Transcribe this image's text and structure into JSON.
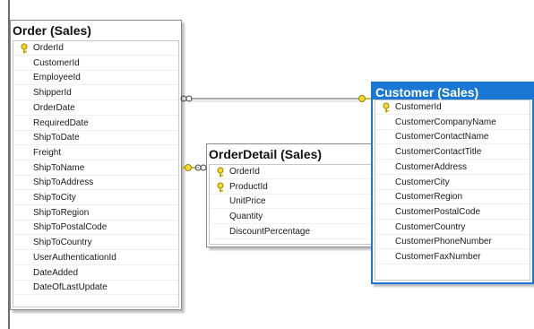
{
  "tables": {
    "order": {
      "title": "Order (Sales)",
      "columns": [
        {
          "name": "OrderId",
          "key": true
        },
        {
          "name": "CustomerId",
          "key": false
        },
        {
          "name": "EmployeeId",
          "key": false
        },
        {
          "name": "ShipperId",
          "key": false
        },
        {
          "name": "OrderDate",
          "key": false
        },
        {
          "name": "RequiredDate",
          "key": false
        },
        {
          "name": "ShipToDate",
          "key": false
        },
        {
          "name": "Freight",
          "key": false
        },
        {
          "name": "ShipToName",
          "key": false
        },
        {
          "name": "ShipToAddress",
          "key": false
        },
        {
          "name": "ShipToCity",
          "key": false
        },
        {
          "name": "ShipToRegion",
          "key": false
        },
        {
          "name": "ShipToPostalCode",
          "key": false
        },
        {
          "name": "ShipToCountry",
          "key": false
        },
        {
          "name": "UserAuthenticationId",
          "key": false
        },
        {
          "name": "DateAdded",
          "key": false
        },
        {
          "name": "DateOfLastUpdate",
          "key": false
        }
      ]
    },
    "orderdetail": {
      "title": "OrderDetail (Sales)",
      "columns": [
        {
          "name": "OrderId",
          "key": true
        },
        {
          "name": "ProductId",
          "key": true
        },
        {
          "name": "UnitPrice",
          "key": false
        },
        {
          "name": "Quantity",
          "key": false
        },
        {
          "name": "DiscountPercentage",
          "key": false
        }
      ]
    },
    "customer": {
      "title": "Customer (Sales)",
      "selected": true,
      "columns": [
        {
          "name": "CustomerId",
          "key": true
        },
        {
          "name": "CustomerCompanyName",
          "key": false
        },
        {
          "name": "CustomerContactName",
          "key": false
        },
        {
          "name": "CustomerContactTitle",
          "key": false
        },
        {
          "name": "CustomerAddress",
          "key": false
        },
        {
          "name": "CustomerCity",
          "key": false
        },
        {
          "name": "CustomerRegion",
          "key": false
        },
        {
          "name": "CustomerPostalCode",
          "key": false
        },
        {
          "name": "CustomerCountry",
          "key": false
        },
        {
          "name": "CustomerPhoneNumber",
          "key": false
        },
        {
          "name": "CustomerFaxNumber",
          "key": false
        }
      ]
    }
  },
  "relationships": [
    {
      "from": "orderdetail",
      "to": "order",
      "many_end": "order",
      "one_end": "orderdetail"
    },
    {
      "from": "order",
      "to": "customer",
      "many_end": "order",
      "one_end": "customer"
    }
  ],
  "colors": {
    "selected_header": "#1a78d4",
    "key_icon": "#e0c020",
    "connector": "#7a7a7a"
  }
}
